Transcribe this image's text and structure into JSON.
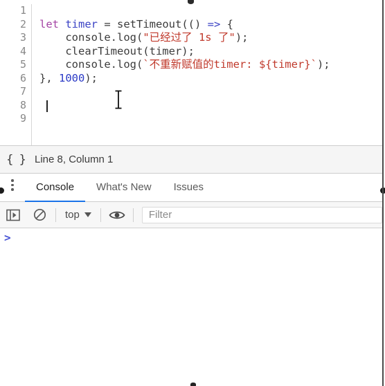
{
  "editor": {
    "line_numbers": [
      "1",
      "2",
      "3",
      "4",
      "5",
      "6",
      "7",
      "8",
      "9"
    ],
    "lines": [
      {
        "n": 1,
        "tokens": []
      },
      {
        "n": 2,
        "tokens": [
          {
            "t": "let",
            "c": "kw"
          },
          {
            "t": " ",
            "c": "plain"
          },
          {
            "t": "timer",
            "c": "var"
          },
          {
            "t": " = setTimeout(() ",
            "c": "plain"
          },
          {
            "t": "=>",
            "c": "arrow"
          },
          {
            "t": " {",
            "c": "plain"
          }
        ]
      },
      {
        "n": 3,
        "tokens": [
          {
            "t": "    console.log(",
            "c": "plain"
          },
          {
            "t": "\"已经过了 1s 了\"",
            "c": "str"
          },
          {
            "t": ");",
            "c": "plain"
          }
        ]
      },
      {
        "n": 4,
        "tokens": [
          {
            "t": "    clearTimeout(timer);",
            "c": "plain"
          }
        ]
      },
      {
        "n": 5,
        "tokens": [
          {
            "t": "    console.log(",
            "c": "plain"
          },
          {
            "t": "`不重新赋值的timer: ${timer}`",
            "c": "tmpl"
          },
          {
            "t": ");",
            "c": "plain"
          }
        ]
      },
      {
        "n": 6,
        "tokens": [
          {
            "t": "}, ",
            "c": "plain"
          },
          {
            "t": "1000",
            "c": "num"
          },
          {
            "t": ");",
            "c": "plain"
          }
        ]
      },
      {
        "n": 7,
        "tokens": []
      },
      {
        "n": 8,
        "tokens": [],
        "caret": true
      },
      {
        "n": 9,
        "tokens": []
      }
    ]
  },
  "statusbar": {
    "format_icon": "{ }",
    "position_text": "Line 8, Column 1"
  },
  "tabs": {
    "menu_icon": "kebab-menu-icon",
    "items": [
      {
        "label": "Console",
        "active": true
      },
      {
        "label": "What's New",
        "active": false
      },
      {
        "label": "Issues",
        "active": false
      }
    ]
  },
  "console_toolbar": {
    "sidebar_toggle_icon": "sidebar-toggle-icon",
    "clear_icon": "clear-console-icon",
    "context_value": "top",
    "dropdown_icon": "chevron-down-icon",
    "eye_icon": "live-expression-eye-icon",
    "filter_placeholder": "Filter"
  },
  "console_body": {
    "prompt_symbol": ">",
    "input_value": ""
  },
  "colors": {
    "accent": "#1a73e8",
    "keyword": "#a545a5",
    "variable": "#3a42c4",
    "string": "#c0392b",
    "number": "#2c3bc6",
    "prompt": "#4a56d6",
    "toolbar_bg": "#f7f7f7",
    "statusbar_bg": "#f5f5f5"
  }
}
